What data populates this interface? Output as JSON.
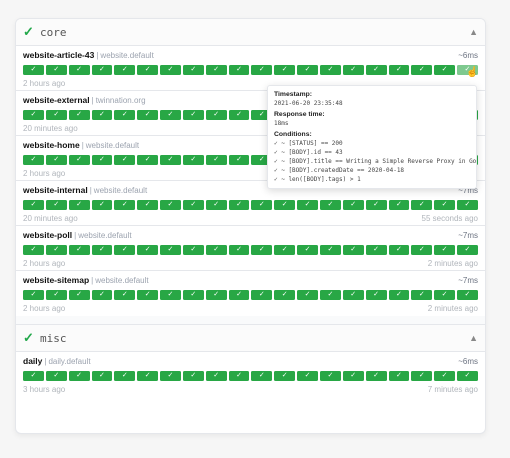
{
  "groups": [
    {
      "name": "core",
      "services": [
        {
          "name": "website-article-43",
          "host": "website.default",
          "response": "~6ms",
          "oldest": "2 hours ago",
          "newest": ""
        },
        {
          "name": "website-external",
          "host": "twinnation.org",
          "response": "",
          "oldest": "20 minutes ago",
          "newest": ""
        },
        {
          "name": "website-home",
          "host": "website.default",
          "response": "",
          "oldest": "2 hours ago",
          "newest": ""
        },
        {
          "name": "website-internal",
          "host": "website.default",
          "response": "~7ms",
          "oldest": "20 minutes ago",
          "newest": "55 seconds ago"
        },
        {
          "name": "website-poll",
          "host": "website.default",
          "response": "~7ms",
          "oldest": "2 hours ago",
          "newest": "2 minutes ago"
        },
        {
          "name": "website-sitemap",
          "host": "website.default",
          "response": "~7ms",
          "oldest": "2 hours ago",
          "newest": "2 minutes ago"
        }
      ]
    },
    {
      "name": "misc",
      "services": [
        {
          "name": "daily",
          "host": "daily.default",
          "response": "~6ms",
          "oldest": "3 hours ago",
          "newest": "7 minutes ago"
        }
      ]
    }
  ],
  "check_mark": "✓",
  "separator": "|",
  "caret": "▲",
  "cursor_glyph": "☝",
  "tooltip": {
    "timestamp_label": "Timestamp:",
    "timestamp_value": "2021-06-20 23:35:48",
    "response_label": "Response time:",
    "response_value": "18ms",
    "conditions_label": "Conditions:",
    "conditions": [
      "✓ ~ [STATUS] == 200",
      "✓ ~ [BODY].id == 43",
      "✓ ~ [BODY].title == Writing a Simple Reverse Proxy in Go",
      "✓ ~ [BODY].createdDate == 2020-04-18",
      "✓ ~ len([BODY].tags) > 1"
    ]
  },
  "colors": {
    "success": "#28a745",
    "hovered": "#7ec98f",
    "group_ok": "#22a84a"
  }
}
